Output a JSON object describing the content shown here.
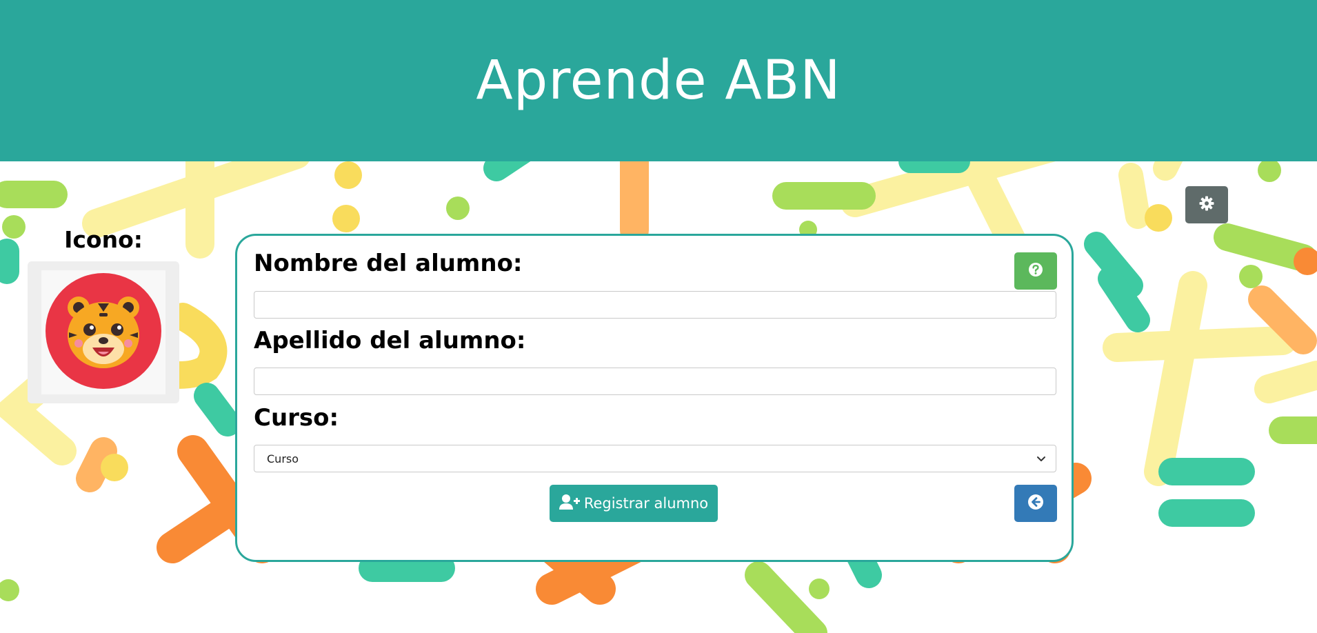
{
  "header": {
    "title": "Aprende ABN",
    "background_color": "#2aa79b"
  },
  "toolbar": {
    "settings_icon": "gear-icon"
  },
  "avatar_panel": {
    "label": "Icono:",
    "selected_icon": "tiger-icon"
  },
  "form": {
    "first_name": {
      "label": "Nombre del alumno:",
      "value": "",
      "placeholder": ""
    },
    "last_name": {
      "label": "Apellido del alumno:",
      "value": "",
      "placeholder": ""
    },
    "course": {
      "label": "Curso:",
      "selected": "Curso"
    },
    "help_icon": "question-circle-icon",
    "register_label": "Registrar alumno",
    "register_icon": "user-plus-icon",
    "back_icon": "arrow-circle-left-icon"
  },
  "colors": {
    "accent": "#2aa79b",
    "help": "#5cb85c",
    "back": "#337ab7",
    "settings": "#5f6b6a"
  }
}
